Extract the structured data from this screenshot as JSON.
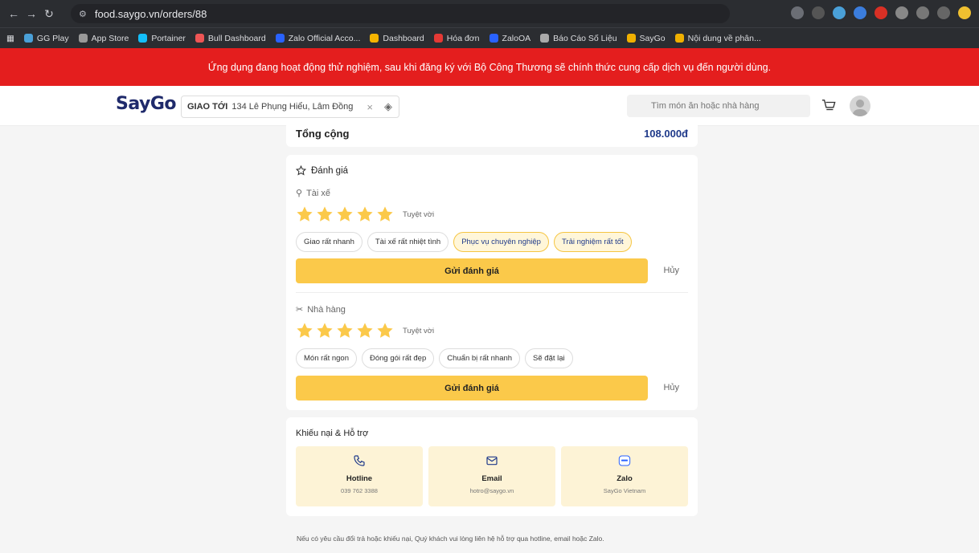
{
  "browser": {
    "url": "food.saygo.vn/orders/88",
    "bookmarks": [
      "GG Play",
      "App Store",
      "Portainer",
      "Bull Dashboard",
      "Zalo Official Acco...",
      "Dashboard",
      "Hóa đơn",
      "ZaloOA",
      "Báo Cáo Số Liệu",
      "SayGo",
      "Nội dung về phân..."
    ]
  },
  "banner": "Ứng dụng đang hoạt động thử nghiệm, sau khi đăng ký với Bộ Công Thương sẽ chính thức cung cấp dịch vụ đến người dùng.",
  "header": {
    "logo": "SayGo",
    "deliver_label": "GIAO TỚI",
    "address": "134 Lê Phụng Hiểu, Lâm Đồng",
    "search_placeholder": "Tìm món ăn hoặc nhà hàng"
  },
  "order": {
    "total_label": "Tổng cộng",
    "total_value": "108.000đ"
  },
  "rating": {
    "title": "Đánh giá",
    "driver": {
      "title": "Tài xế",
      "stars": 5,
      "stars_label": "Tuyệt vời",
      "chips": [
        {
          "label": "Giao rất nhanh",
          "selected": false
        },
        {
          "label": "Tài xế rất nhiệt tình",
          "selected": false
        },
        {
          "label": "Phục vụ chuyên nghiệp",
          "selected": true
        },
        {
          "label": "Trải nghiệm rất tốt",
          "selected": true
        }
      ],
      "submit": "Gửi đánh giá",
      "cancel": "Hủy"
    },
    "restaurant": {
      "title": "Nhà hàng",
      "stars": 5,
      "stars_label": "Tuyệt vời",
      "chips": [
        {
          "label": "Món rất ngon",
          "selected": false
        },
        {
          "label": "Đóng gói rất đẹp",
          "selected": false
        },
        {
          "label": "Chuẩn bị rất nhanh",
          "selected": false
        },
        {
          "label": "Sẽ đặt lại",
          "selected": false
        }
      ],
      "submit": "Gửi đánh giá",
      "cancel": "Hủy"
    }
  },
  "support": {
    "title": "Khiếu nại & Hỗ trợ",
    "items": [
      {
        "name": "Hotline",
        "value": "039 762 3388",
        "icon": "phone-icon"
      },
      {
        "name": "Email",
        "value": "hotro@saygo.vn",
        "icon": "mail-icon"
      },
      {
        "name": "Zalo",
        "value": "SayGo Vietnam",
        "icon": "zalo-icon"
      }
    ]
  },
  "footer_note": "Nếu có yêu cầu đổi trả hoặc khiếu nại, Quý khách vui lòng liên hệ hỗ trợ qua hotline, email hoặc Zalo.",
  "colors": {
    "banner": "#e41e1e",
    "accent": "#fbc94a",
    "brand": "#1f2a6b"
  }
}
